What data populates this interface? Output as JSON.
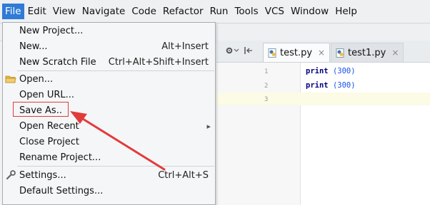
{
  "menubar": {
    "items": [
      "File",
      "Edit",
      "View",
      "Navigate",
      "Code",
      "Refactor",
      "Run",
      "Tools",
      "VCS",
      "Window",
      "Help"
    ],
    "active_index": 0
  },
  "file_menu": {
    "items": [
      {
        "label": "New Project...",
        "shortcut": ""
      },
      {
        "label": "New...",
        "shortcut": "Alt+Insert"
      },
      {
        "label": "New Scratch File",
        "shortcut": "Ctrl+Alt+Shift+Insert"
      },
      {
        "label": "Open...",
        "shortcut": "",
        "icon": "folder-icon"
      },
      {
        "label": "Open URL...",
        "shortcut": ""
      },
      {
        "label": "Save As..",
        "shortcut": "",
        "highlighted": true
      },
      {
        "label": "Open Recent",
        "shortcut": "",
        "submenu": true
      },
      {
        "label": "Close Project",
        "shortcut": ""
      },
      {
        "label": "Rename Project...",
        "shortcut": ""
      },
      {
        "label": "Settings...",
        "shortcut": "Ctrl+Alt+S",
        "icon": "wrench-icon"
      },
      {
        "label": "Default Settings...",
        "shortcut": ""
      }
    ]
  },
  "editor": {
    "tabs": [
      {
        "label": "test.py",
        "active": true
      },
      {
        "label": "test1.py",
        "active": false
      }
    ],
    "line_numbers": [
      "1",
      "2",
      "3"
    ],
    "lines": [
      {
        "keyword": "print",
        "arg": "(300)"
      },
      {
        "keyword": "print",
        "arg": "(300)"
      }
    ]
  },
  "colors": {
    "menu_active_bg": "#2f7bd6",
    "annotation_red": "#e23b3b"
  }
}
